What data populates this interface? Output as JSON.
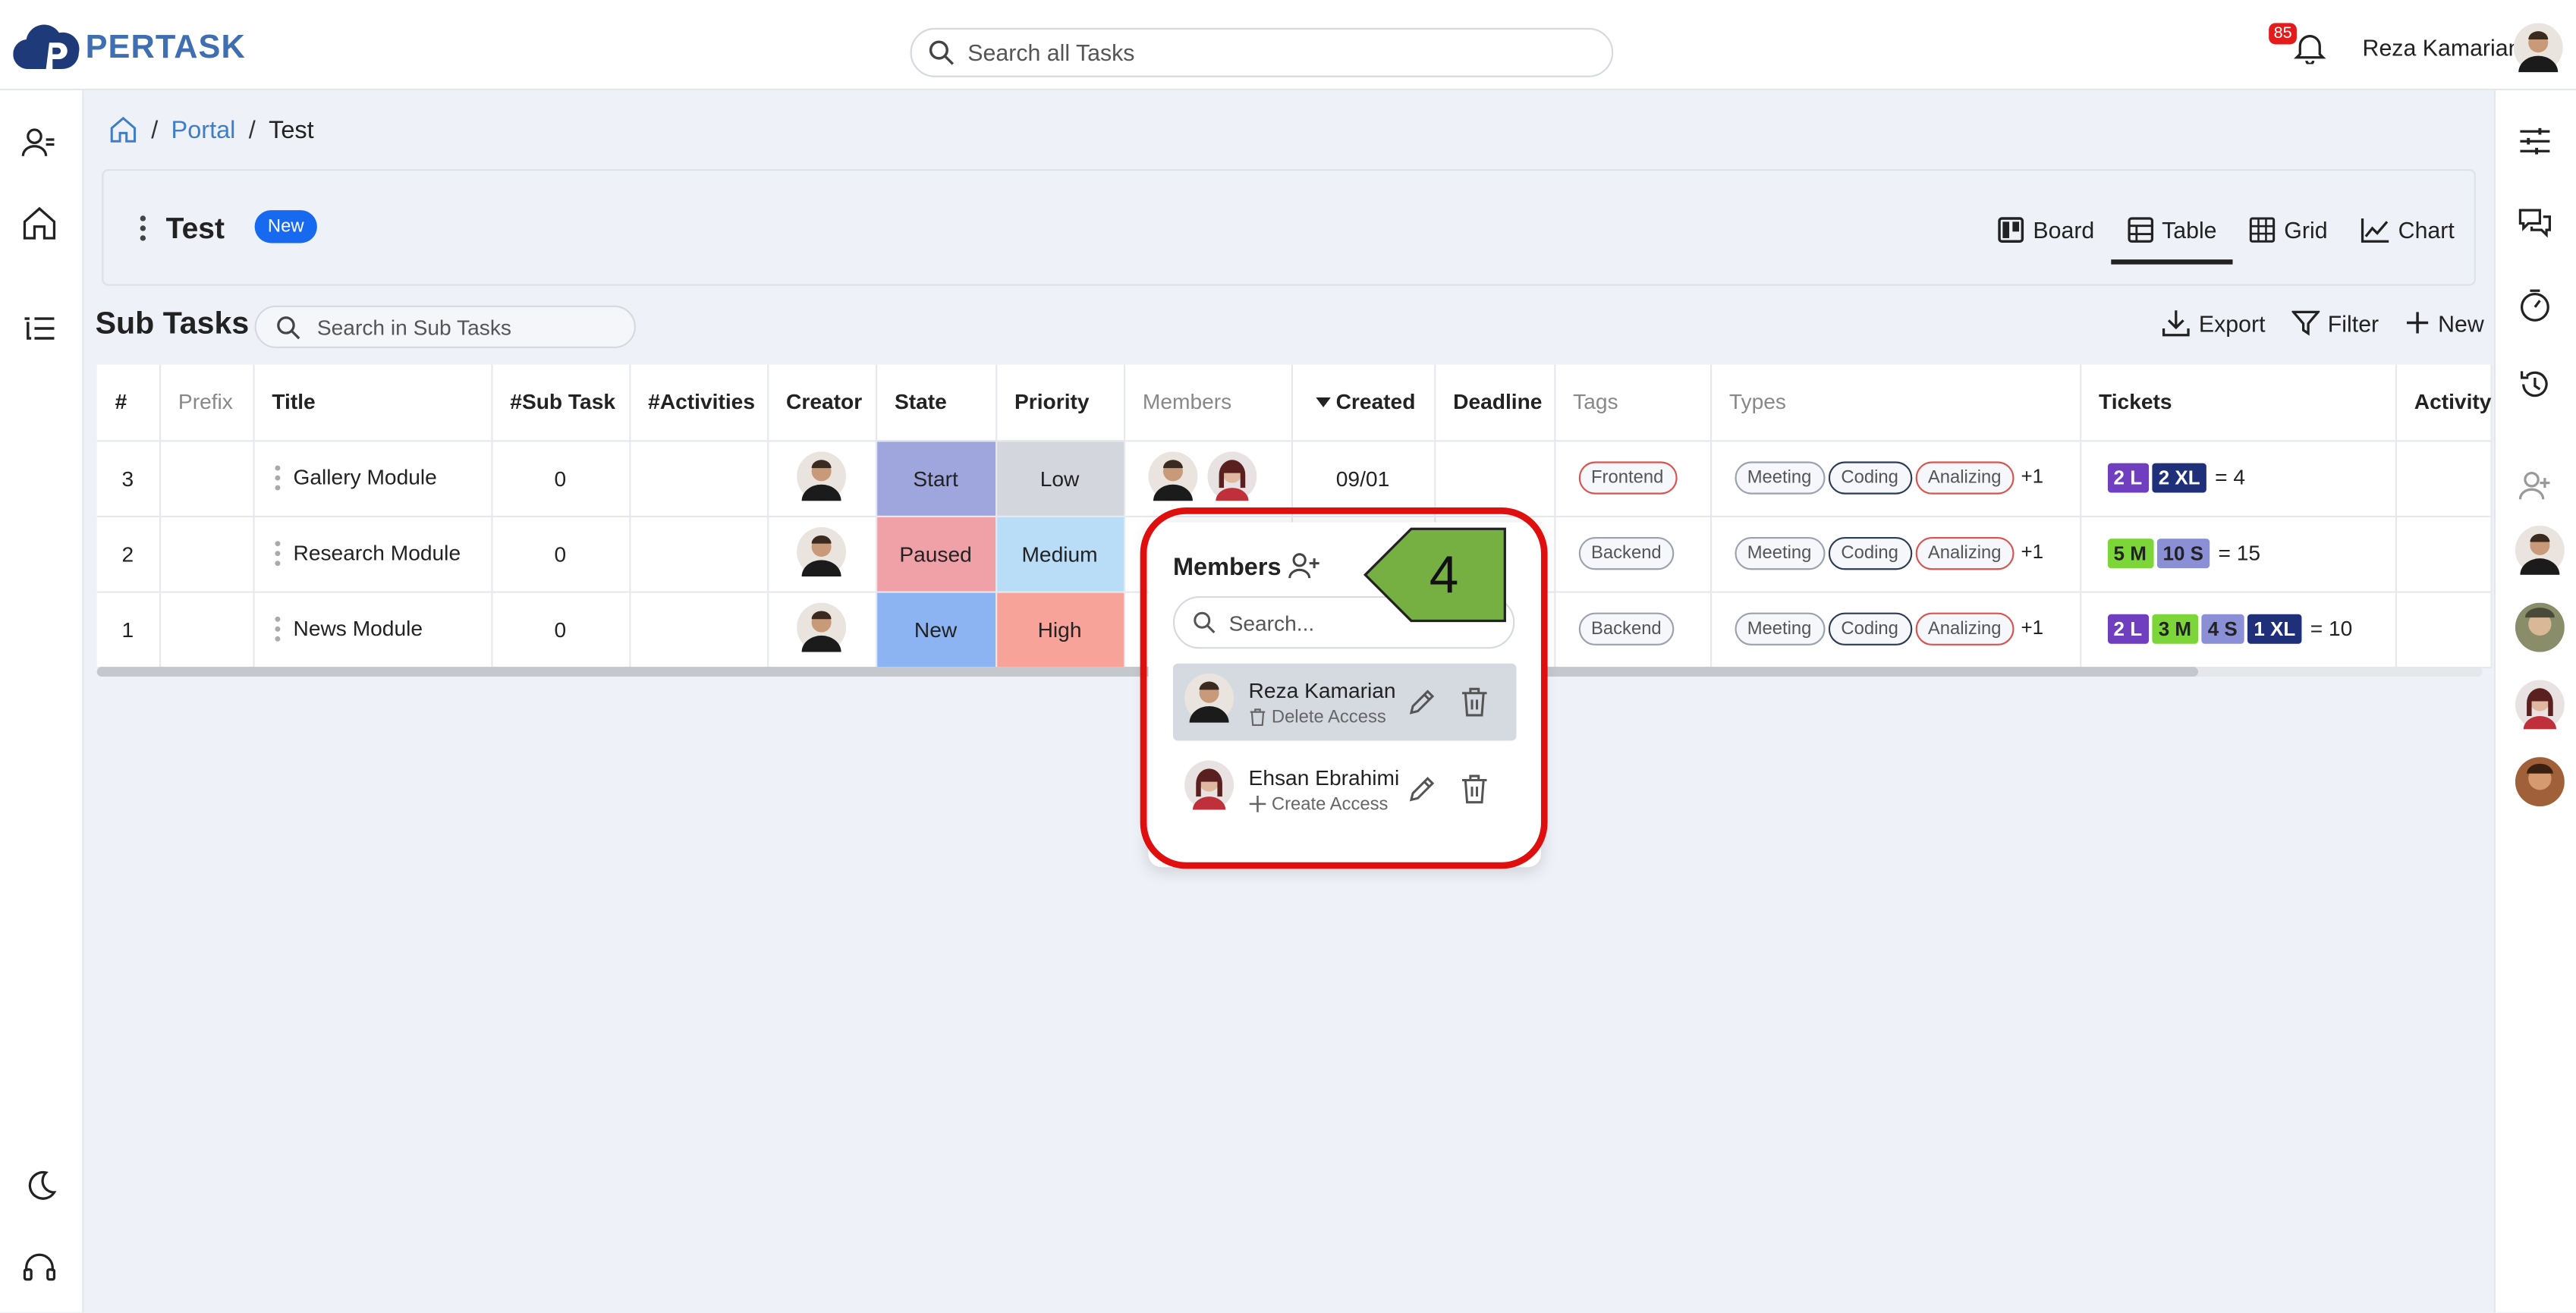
{
  "app": {
    "logo_text": "PERTASK"
  },
  "topbar": {
    "search_placeholder": "Search all Tasks",
    "notification_count": "85",
    "user_name": "Reza Kamarian"
  },
  "breadcrumb": {
    "portal": "Portal",
    "current": "Test",
    "sep1": "/",
    "sep2": "/"
  },
  "header": {
    "title": "Test",
    "badge": "New",
    "views": [
      {
        "label": "Board",
        "active": false
      },
      {
        "label": "Table",
        "active": true
      },
      {
        "label": "Grid",
        "active": false
      },
      {
        "label": "Chart",
        "active": false
      }
    ]
  },
  "subtasks": {
    "title": "Sub Tasks",
    "search_placeholder": "Search in Sub Tasks",
    "actions": {
      "export": "Export",
      "filter": "Filter",
      "new": "New"
    },
    "columns": [
      "#",
      "Prefix",
      "Title",
      "#Sub Task",
      "#Activities",
      "Creator",
      "State",
      "Priority",
      "Members",
      "Created",
      "Deadline",
      "Tags",
      "Types",
      "Tickets",
      "Activity"
    ],
    "rows": [
      {
        "num": "3",
        "title": "Gallery Module",
        "subtask": "0",
        "state": "Start",
        "state_color": "#9fa6dd",
        "priority": "Low",
        "priority_color": "#d3d6dc",
        "created": "09/01",
        "tag": "Frontend",
        "types": [
          "Meeting",
          "Coding",
          "Analizing"
        ],
        "types_more": "+1",
        "tickets": [
          {
            "label": "2 L",
            "color": "#6f3fc0"
          },
          {
            "label": "2 XL",
            "color": "#1f2f7a"
          }
        ],
        "tickets_total": "= 4"
      },
      {
        "num": "2",
        "title": "Research Module",
        "subtask": "0",
        "state": "Paused",
        "state_color": "#f0a1a8",
        "priority": "Medium",
        "priority_color": "#b9dcf7",
        "created": "",
        "tag": "Backend",
        "types": [
          "Meeting",
          "Coding",
          "Analizing"
        ],
        "types_more": "+1",
        "tickets": [
          {
            "label": "5 M",
            "color": "#7cd63a",
            "text": "#222"
          },
          {
            "label": "10 S",
            "color": "#8a8fd6",
            "text": "#222"
          }
        ],
        "tickets_total": "= 15"
      },
      {
        "num": "1",
        "title": "News Module",
        "subtask": "0",
        "state": "New",
        "state_color": "#8cb3f2",
        "priority": "High",
        "priority_color": "#f7a39a",
        "created": "",
        "tag": "Backend",
        "types": [
          "Meeting",
          "Coding",
          "Analizing"
        ],
        "types_more": "+1",
        "tickets": [
          {
            "label": "2 L",
            "color": "#6f3fc0"
          },
          {
            "label": "3 M",
            "color": "#7cd63a",
            "text": "#222"
          },
          {
            "label": "4 S",
            "color": "#8a8fd6",
            "text": "#222"
          },
          {
            "label": "1 XL",
            "color": "#1f2f7a"
          }
        ],
        "tickets_total": "= 10"
      }
    ]
  },
  "members_popup": {
    "title": "Members",
    "search_placeholder": "Search...",
    "members": [
      {
        "name": "Reza Kamarian",
        "access": "Delete Access",
        "selected": true
      },
      {
        "name": "Ehsan Ebrahimi",
        "access": "Create Access",
        "selected": false
      }
    ]
  },
  "callout": {
    "label": "4",
    "color": "#76b043"
  }
}
